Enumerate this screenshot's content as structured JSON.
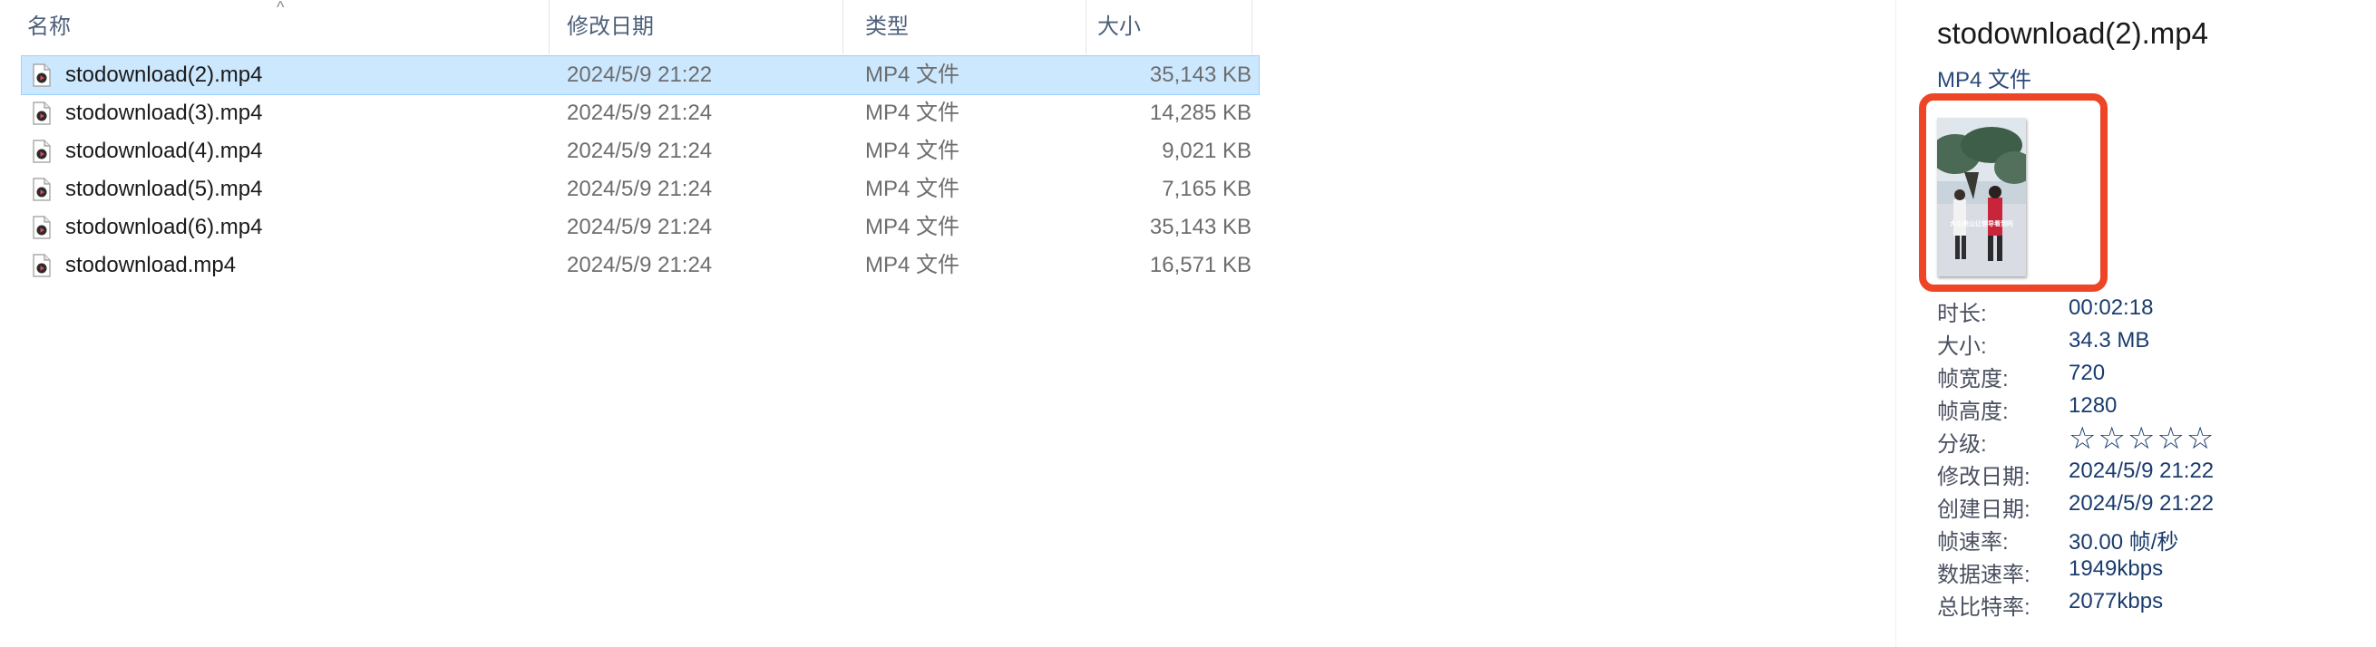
{
  "columns": {
    "name": "名称",
    "date": "修改日期",
    "type": "类型",
    "size": "大小"
  },
  "files": [
    {
      "name": "stodownload(2).mp4",
      "date": "2024/5/9 21:22",
      "type": "MP4 文件",
      "size": "35,143 KB",
      "selected": true
    },
    {
      "name": "stodownload(3).mp4",
      "date": "2024/5/9 21:24",
      "type": "MP4 文件",
      "size": "14,285 KB"
    },
    {
      "name": "stodownload(4).mp4",
      "date": "2024/5/9 21:24",
      "type": "MP4 文件",
      "size": "9,021 KB"
    },
    {
      "name": "stodownload(5).mp4",
      "date": "2024/5/9 21:24",
      "type": "MP4 文件",
      "size": "7,165 KB"
    },
    {
      "name": "stodownload(6).mp4",
      "date": "2024/5/9 21:24",
      "type": "MP4 文件",
      "size": "35,143 KB"
    },
    {
      "name": "stodownload.mp4",
      "date": "2024/5/9 21:24",
      "type": "MP4 文件",
      "size": "16,571 KB"
    }
  ],
  "preview": {
    "title": "stodownload(2).mp4",
    "type": "MP4 文件",
    "thumbnail_caption": "大小夹山让领导看到吗",
    "highlight_color": "#ee4526",
    "properties": [
      {
        "key": "时长:",
        "value": "00:02:18"
      },
      {
        "key": "大小:",
        "value": "34.3 MB"
      },
      {
        "key": "帧宽度:",
        "value": "720"
      },
      {
        "key": "帧高度:",
        "value": "1280"
      },
      {
        "key": "分级:",
        "value": "☆☆☆☆☆",
        "rating": 0
      },
      {
        "key": "修改日期:",
        "value": "2024/5/9 21:22"
      },
      {
        "key": "创建日期:",
        "value": "2024/5/9 21:22"
      },
      {
        "key": "帧速率:",
        "value": "30.00 帧/秒"
      },
      {
        "key": "数据速率:",
        "value": "1949kbps"
      },
      {
        "key": "总比特率:",
        "value": "2077kbps"
      }
    ]
  },
  "icons": {
    "file": "video-file-icon",
    "sort": "sort-up-icon"
  }
}
